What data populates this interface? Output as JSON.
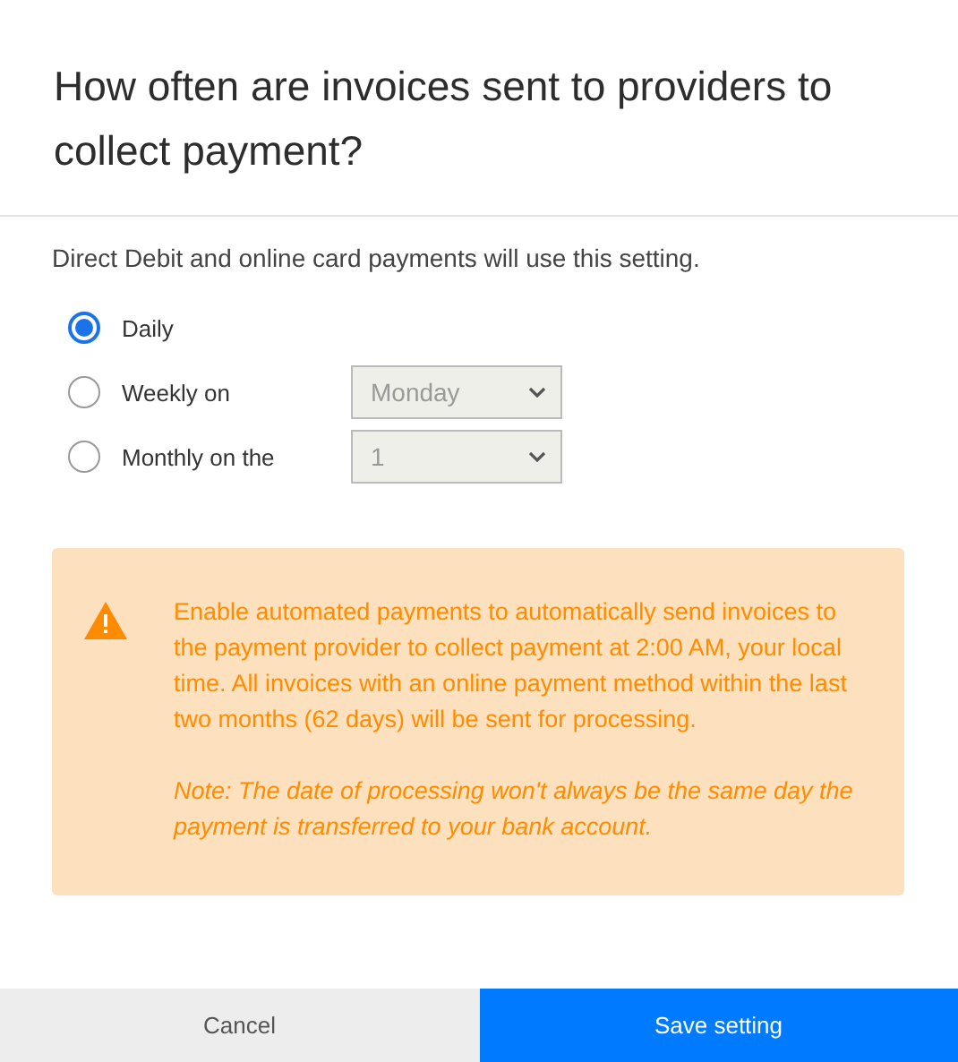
{
  "dialog": {
    "title": "How often are invoices sent to providers to collect payment?"
  },
  "description": "Direct Debit and online card payments will use this setting.",
  "options": [
    {
      "label": "Daily",
      "selected": true
    },
    {
      "label": "Weekly on",
      "selected": false,
      "select": {
        "value": "Monday",
        "disabled": true
      }
    },
    {
      "label": "Monthly on the",
      "selected": false,
      "select": {
        "value": "1",
        "disabled": true
      }
    }
  ],
  "alert": {
    "kind": "warning",
    "message": "Enable automated payments to automatically send invoices to the payment provider to collect payment at 2:00 AM, your local time. All invoices with an online payment method within the last two months (62 days) will be sent for processing.",
    "note": "Note: The date of processing won't always be the same day the payment is transferred to your bank account."
  },
  "buttons": [
    {
      "label": "Cancel",
      "kind": "secondary"
    },
    {
      "label": "Save setting",
      "kind": "primary"
    }
  ]
}
